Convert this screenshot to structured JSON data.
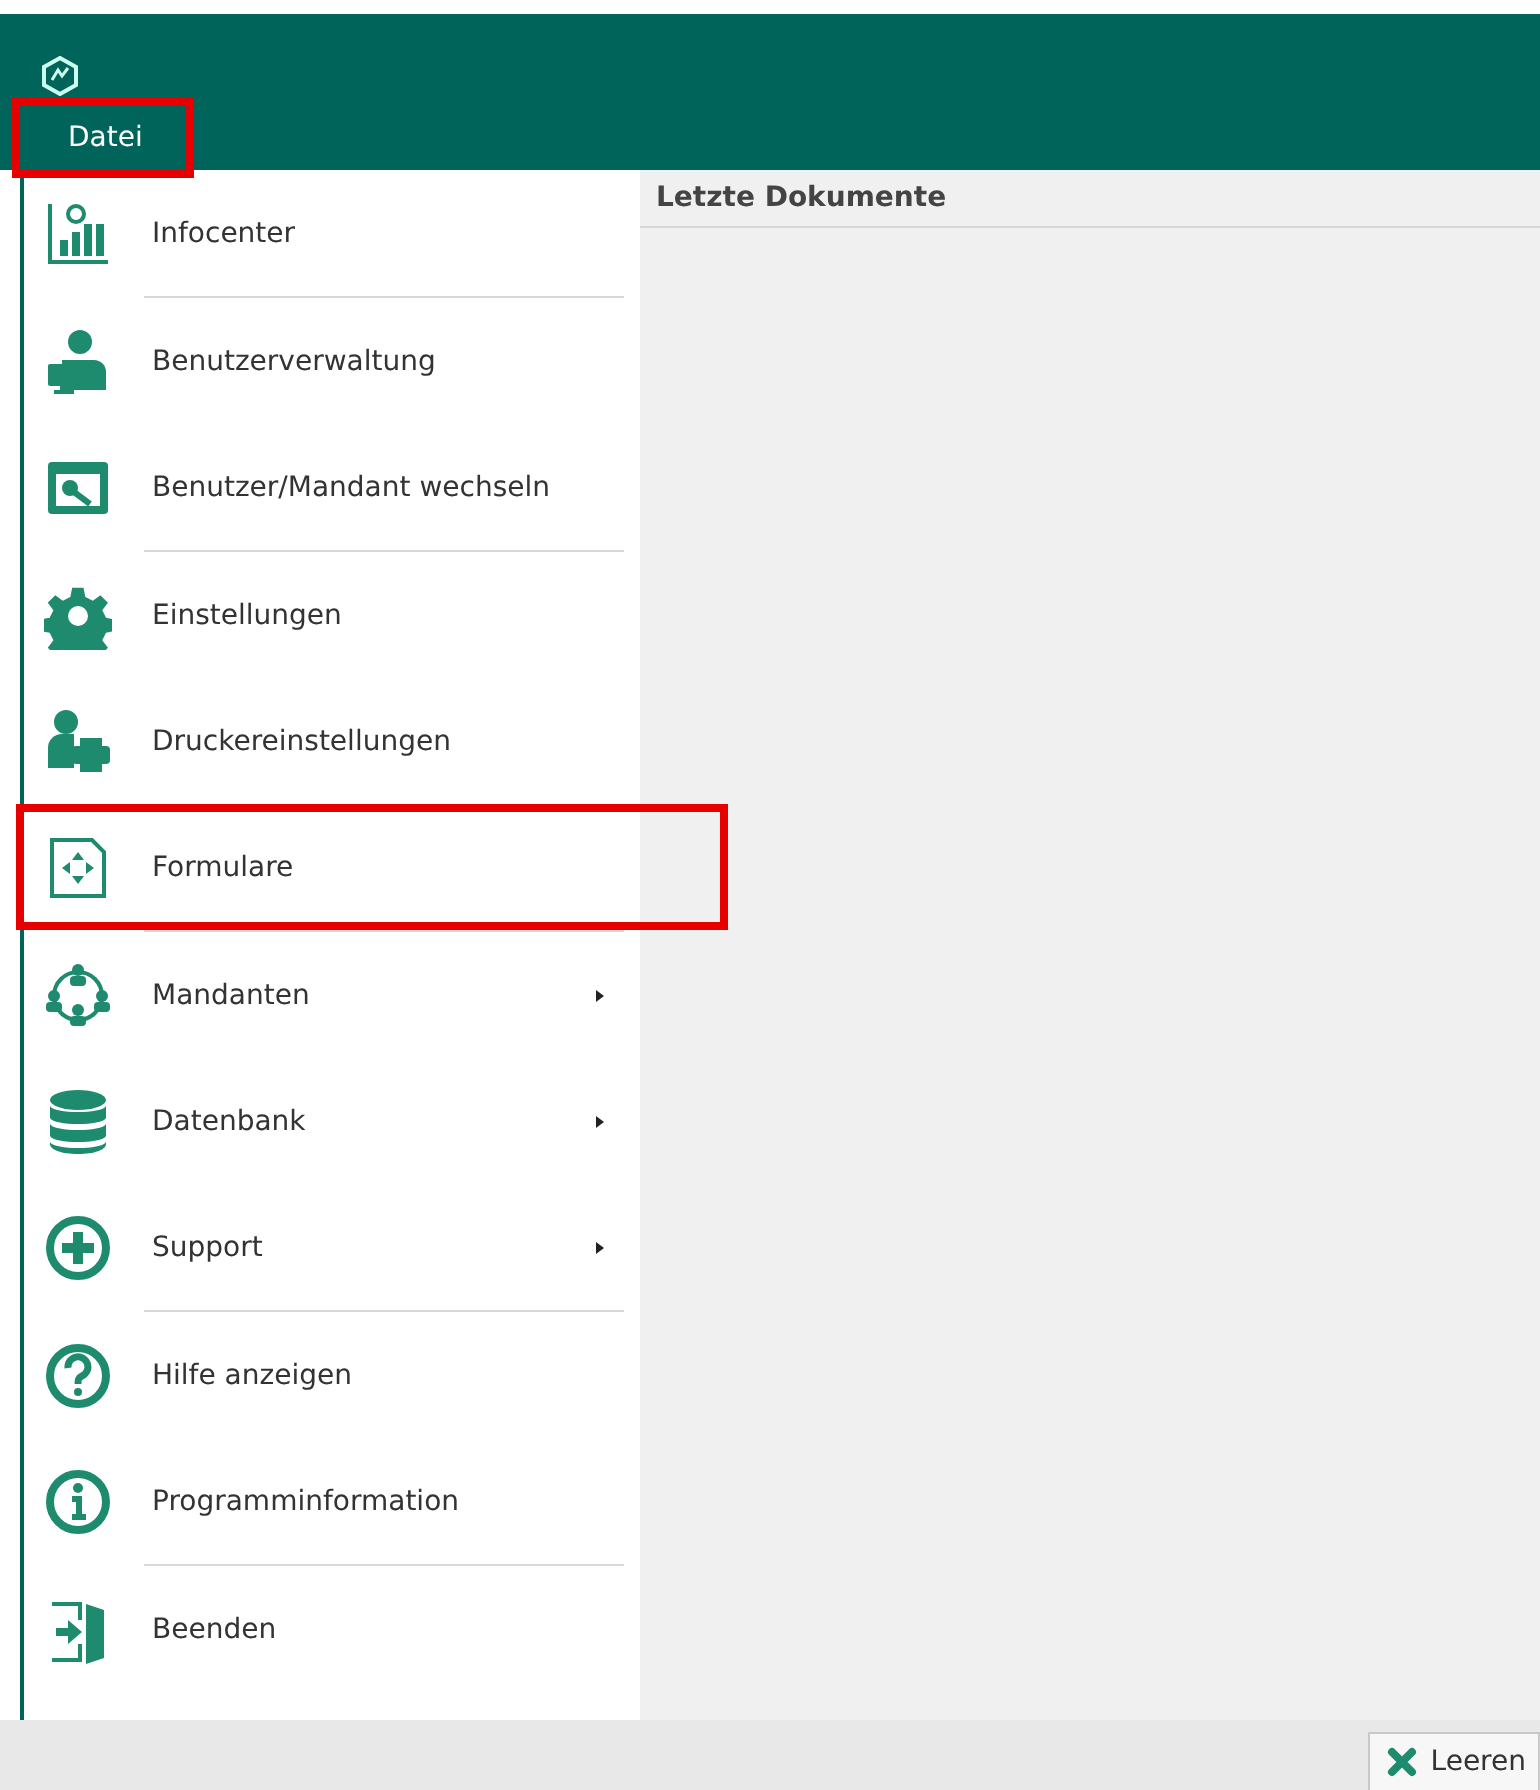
{
  "ribbon": {
    "tab": {
      "label": "Datei",
      "highlighted": true
    }
  },
  "menu": [
    {
      "kind": "item",
      "label": "Infocenter",
      "has_submenu": false,
      "highlighted": false
    },
    {
      "kind": "separator"
    },
    {
      "kind": "item",
      "label": "Benutzerverwaltung",
      "has_submenu": false,
      "highlighted": false
    },
    {
      "kind": "item",
      "label": "Benutzer/Mandant wechseln",
      "has_submenu": false,
      "highlighted": false
    },
    {
      "kind": "separator"
    },
    {
      "kind": "item",
      "label": "Einstellungen",
      "has_submenu": false,
      "highlighted": false
    },
    {
      "kind": "item",
      "label": "Druckereinstellungen",
      "has_submenu": false,
      "highlighted": false
    },
    {
      "kind": "item",
      "label": "Formulare",
      "has_submenu": false,
      "highlighted": true
    },
    {
      "kind": "separator"
    },
    {
      "kind": "item",
      "label": "Mandanten",
      "has_submenu": true,
      "highlighted": false
    },
    {
      "kind": "item",
      "label": "Datenbank",
      "has_submenu": true,
      "highlighted": false
    },
    {
      "kind": "item",
      "label": "Support",
      "has_submenu": true,
      "highlighted": false
    },
    {
      "kind": "separator"
    },
    {
      "kind": "item",
      "label": "Hilfe anzeigen",
      "has_submenu": false,
      "highlighted": false
    },
    {
      "kind": "item",
      "label": "Programminformation",
      "has_submenu": false,
      "highlighted": false
    },
    {
      "kind": "separator"
    },
    {
      "kind": "item",
      "label": "Beenden",
      "has_submenu": false,
      "highlighted": false
    }
  ],
  "recent_documents": {
    "title": "Letzte Dokumente"
  },
  "footer": {
    "clear_button": "Leeren"
  }
}
